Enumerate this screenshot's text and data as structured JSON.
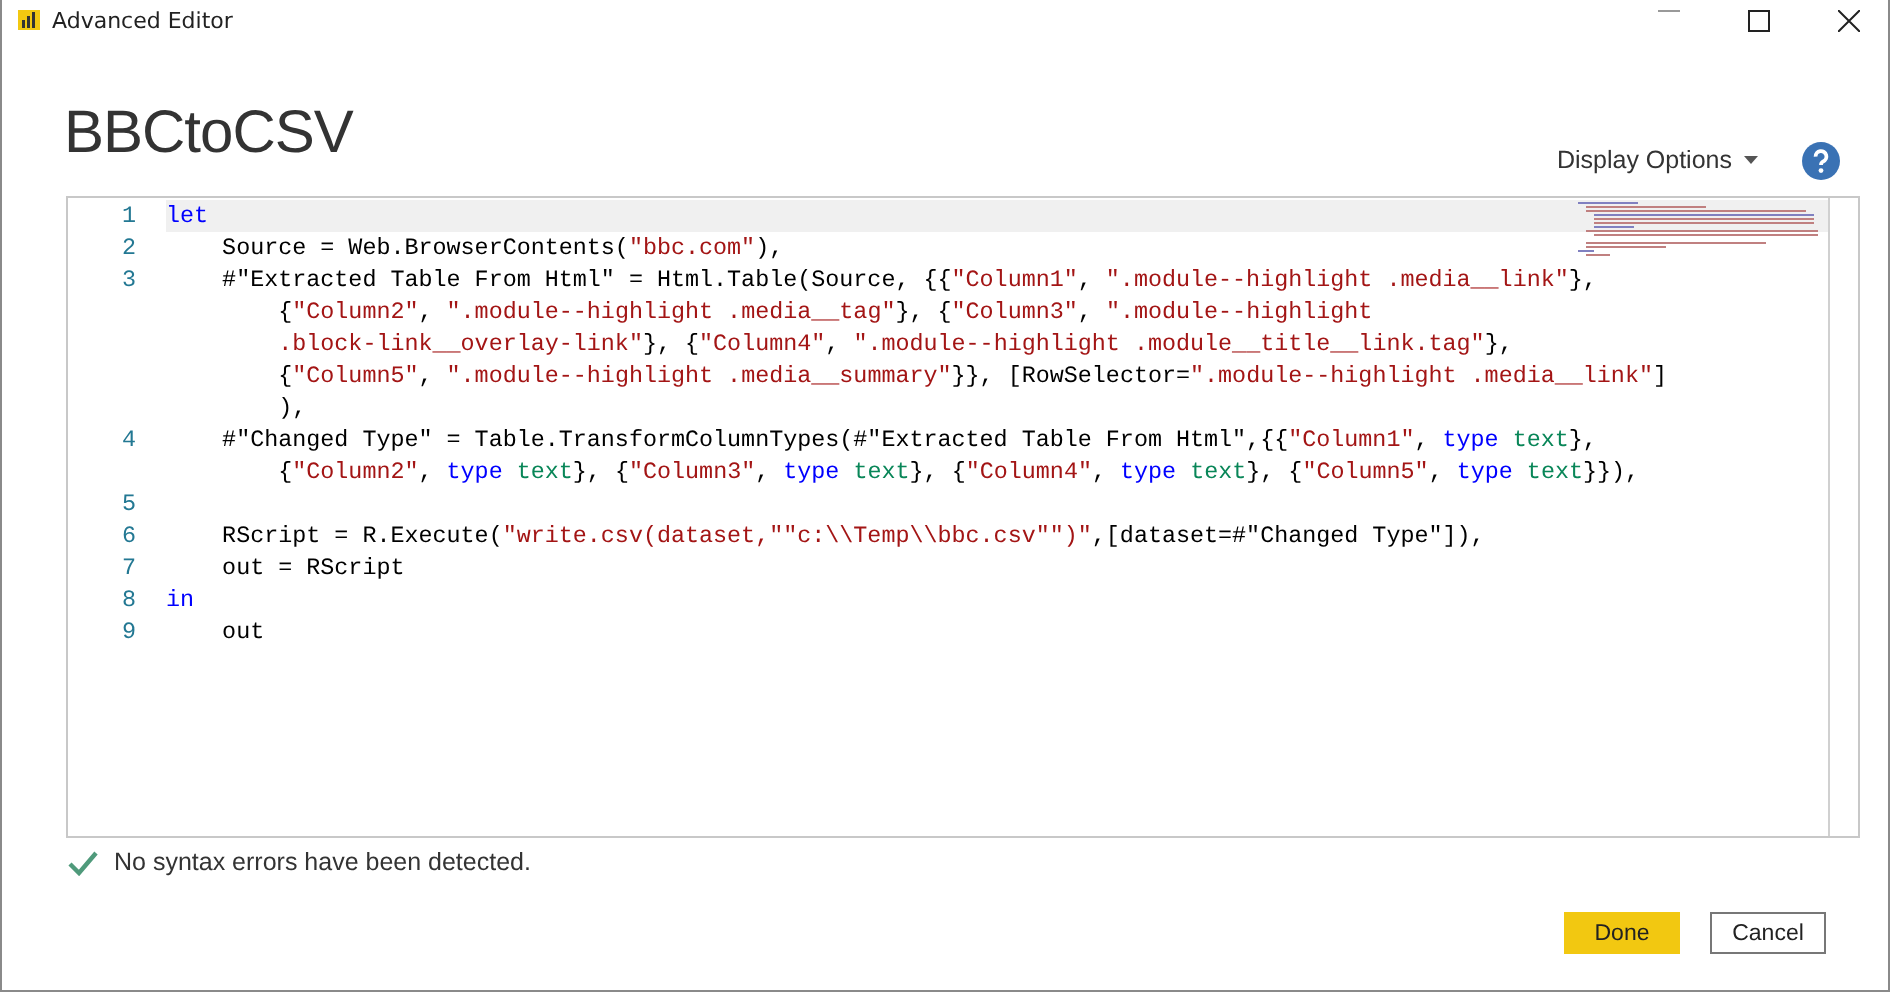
{
  "window": {
    "title": "Advanced Editor"
  },
  "query_name": "BBCtoCSV",
  "display_options": {
    "label": "Display Options"
  },
  "code_lines": [
    {
      "number": "1",
      "selected": true,
      "tokens": [
        {
          "kind": "keyword",
          "text": "let"
        }
      ]
    },
    {
      "number": "2",
      "selected": false,
      "tokens": [
        {
          "kind": "plain",
          "text": "    Source = Web.BrowserContents("
        },
        {
          "kind": "string",
          "text": "\"bbc.com\""
        },
        {
          "kind": "plain",
          "text": "),"
        }
      ]
    },
    {
      "number": "3",
      "selected": false,
      "tokens": [
        {
          "kind": "plain",
          "text": "    #\"Extracted Table From Html\" = Html.Table(Source, {{"
        },
        {
          "kind": "string",
          "text": "\"Column1\""
        },
        {
          "kind": "plain",
          "text": ", "
        },
        {
          "kind": "string",
          "text": "\".module--highlight .media__link\""
        },
        {
          "kind": "plain",
          "text": "},"
        }
      ]
    },
    {
      "selected": false,
      "tokens": [
        {
          "kind": "plain",
          "text": "        {"
        },
        {
          "kind": "string",
          "text": "\"Column2\""
        },
        {
          "kind": "plain",
          "text": ", "
        },
        {
          "kind": "string",
          "text": "\".module--highlight .media__tag\""
        },
        {
          "kind": "plain",
          "text": "}, {"
        },
        {
          "kind": "string",
          "text": "\"Column3\""
        },
        {
          "kind": "plain",
          "text": ", "
        },
        {
          "kind": "string",
          "text": "\".module--highlight"
        }
      ]
    },
    {
      "selected": false,
      "tokens": [
        {
          "kind": "string",
          "text": "        .block-link__overlay-link\""
        },
        {
          "kind": "plain",
          "text": "}, {"
        },
        {
          "kind": "string",
          "text": "\"Column4\""
        },
        {
          "kind": "plain",
          "text": ", "
        },
        {
          "kind": "string",
          "text": "\".module--highlight .module__title__link.tag\""
        },
        {
          "kind": "plain",
          "text": "},"
        }
      ]
    },
    {
      "selected": false,
      "tokens": [
        {
          "kind": "plain",
          "text": "        {"
        },
        {
          "kind": "string",
          "text": "\"Column5\""
        },
        {
          "kind": "plain",
          "text": ", "
        },
        {
          "kind": "string",
          "text": "\".module--highlight .media__summary\""
        },
        {
          "kind": "plain",
          "text": "}}, [RowSelector="
        },
        {
          "kind": "string",
          "text": "\".module--highlight .media__link\""
        },
        {
          "kind": "plain",
          "text": "]"
        }
      ]
    },
    {
      "selected": false,
      "tokens": [
        {
          "kind": "plain",
          "text": "        ),"
        }
      ]
    },
    {
      "number": "4",
      "selected": false,
      "tokens": [
        {
          "kind": "plain",
          "text": "    #\"Changed Type\" = Table.TransformColumnTypes(#\"Extracted Table From Html\",{{"
        },
        {
          "kind": "string",
          "text": "\"Column1\""
        },
        {
          "kind": "plain",
          "text": ", "
        },
        {
          "kind": "keyword",
          "text": "type"
        },
        {
          "kind": "type",
          "text": " text"
        },
        {
          "kind": "plain",
          "text": "},"
        }
      ]
    },
    {
      "selected": false,
      "tokens": [
        {
          "kind": "plain",
          "text": "        {"
        },
        {
          "kind": "string",
          "text": "\"Column2\""
        },
        {
          "kind": "plain",
          "text": ", "
        },
        {
          "kind": "keyword",
          "text": "type"
        },
        {
          "kind": "type",
          "text": " text"
        },
        {
          "kind": "plain",
          "text": "}, {"
        },
        {
          "kind": "string",
          "text": "\"Column3\""
        },
        {
          "kind": "plain",
          "text": ", "
        },
        {
          "kind": "keyword",
          "text": "type"
        },
        {
          "kind": "type",
          "text": " text"
        },
        {
          "kind": "plain",
          "text": "}, {"
        },
        {
          "kind": "string",
          "text": "\"Column4\""
        },
        {
          "kind": "plain",
          "text": ", "
        },
        {
          "kind": "keyword",
          "text": "type"
        },
        {
          "kind": "type",
          "text": " text"
        },
        {
          "kind": "plain",
          "text": "}, {"
        },
        {
          "kind": "string",
          "text": "\"Column5\""
        },
        {
          "kind": "plain",
          "text": ", "
        },
        {
          "kind": "keyword",
          "text": "type"
        },
        {
          "kind": "type",
          "text": " text"
        },
        {
          "kind": "plain",
          "text": "}}),"
        }
      ]
    },
    {
      "number": "5",
      "selected": false
    },
    {
      "number": "6",
      "selected": false,
      "tokens": [
        {
          "kind": "plain",
          "text": "    RScript = R.Execute("
        },
        {
          "kind": "string",
          "text": "\"write.csv(dataset,\"\"c:\\\\Temp\\\\bbc.csv\"\")\""
        },
        {
          "kind": "plain",
          "text": ",[dataset=#\"Changed Type\"]),"
        }
      ]
    },
    {
      "number": "7",
      "selected": false,
      "tokens": [
        {
          "kind": "plain",
          "text": "    out = RScript"
        }
      ]
    },
    {
      "number": "8",
      "selected": false,
      "tokens": [
        {
          "kind": "keyword",
          "text": "in"
        }
      ]
    },
    {
      "number": "9",
      "selected": false,
      "tokens": [
        {
          "kind": "plain",
          "text": "    out"
        }
      ]
    }
  ],
  "status": {
    "text": "No syntax errors have been detected."
  },
  "buttons": [
    {
      "label": "Done",
      "kind": "primary"
    },
    {
      "label": "Cancel",
      "kind": "secondary"
    }
  ]
}
